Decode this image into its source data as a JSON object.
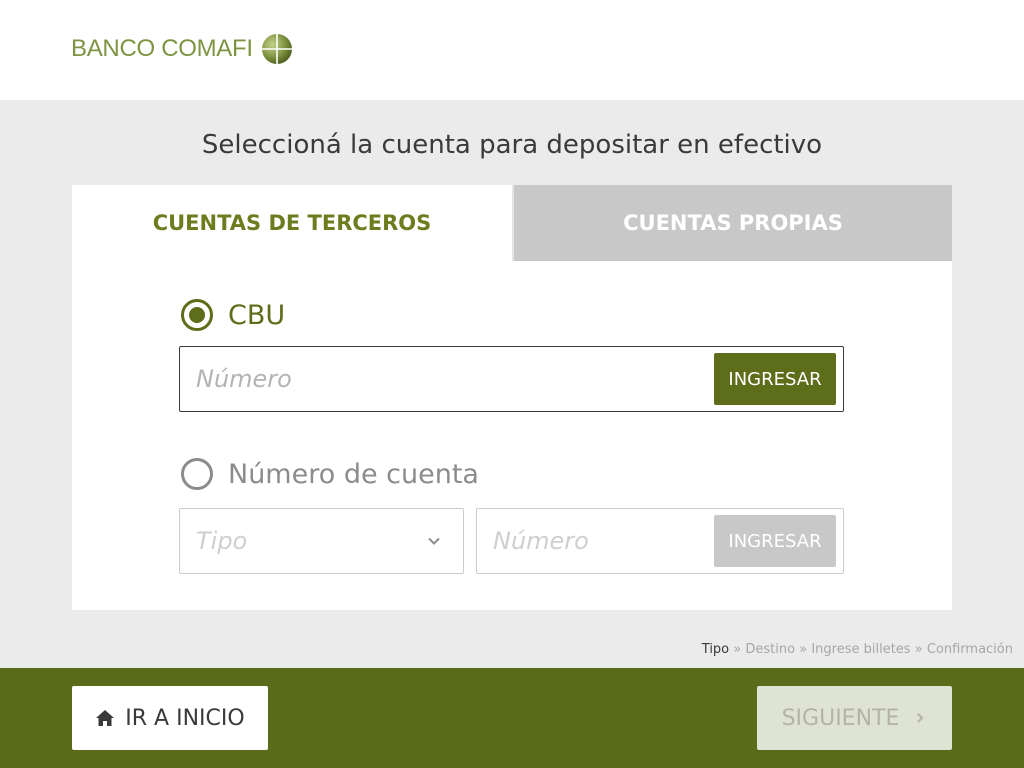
{
  "header": {
    "logo_text": "BANCO COMAFI",
    "logo_icon": "comafi-globe-icon"
  },
  "page": {
    "title": "Seleccioná la cuenta para depositar en efectivo"
  },
  "tabs": [
    {
      "label": "CUENTAS DE TERCEROS",
      "active": true
    },
    {
      "label": "CUENTAS PROPIAS",
      "active": false
    }
  ],
  "cbu": {
    "label": "CBU",
    "selected": true,
    "placeholder": "Número",
    "button_label": "INGRESAR"
  },
  "cuenta": {
    "label": "Número de cuenta",
    "selected": false,
    "tipo_placeholder": "Tipo",
    "numero_placeholder": "Número",
    "button_label": "INGRESAR"
  },
  "breadcrumb": {
    "steps": [
      "Tipo",
      "Destino",
      "Ingrese billetes",
      "Confirmación"
    ],
    "separator": "»",
    "current": "Tipo"
  },
  "footer": {
    "home_label": "IR A INICIO",
    "next_label": "SIGUIENTE"
  },
  "colors": {
    "brand_green": "#5a6b19",
    "tab_active_text": "#6b7d1e",
    "logo_green": "#7f9442",
    "disabled_gray": "#c8c8c8"
  }
}
